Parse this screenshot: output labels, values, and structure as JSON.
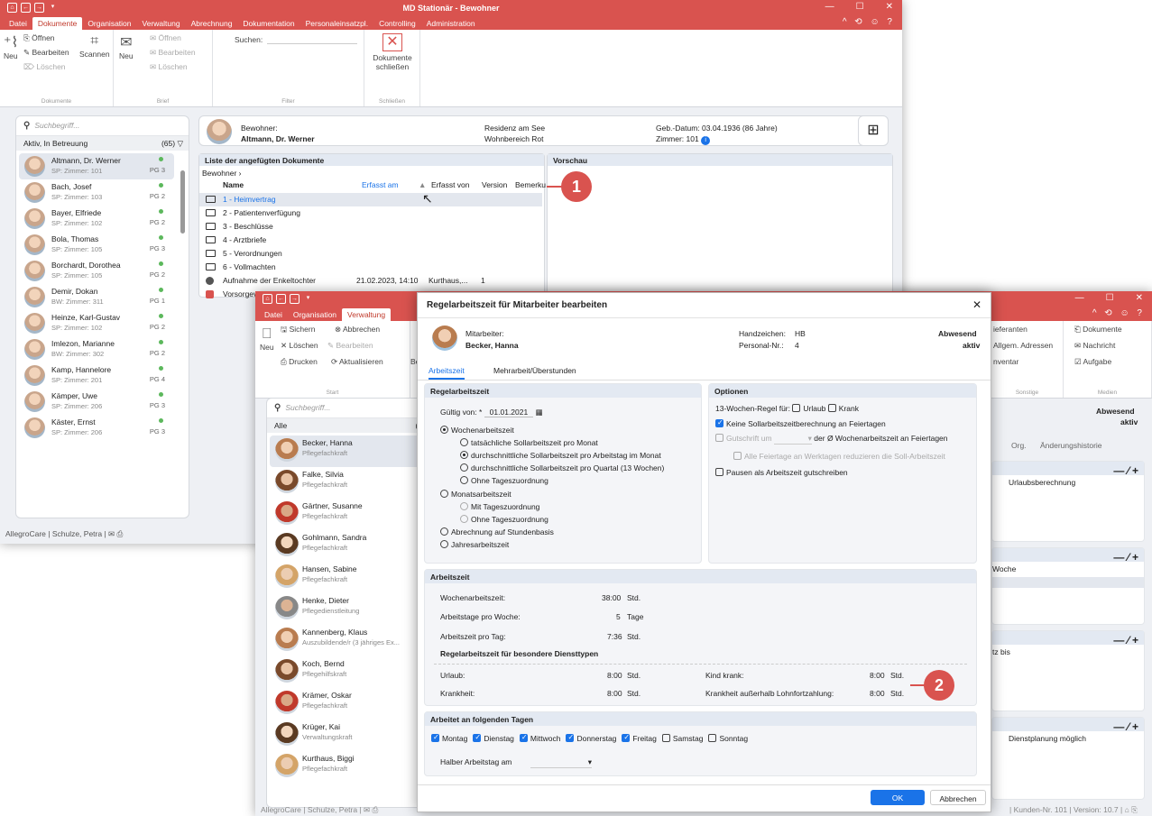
{
  "win1": {
    "title": "MD Stationär - Bewohner",
    "menu": [
      "Datei",
      "Dokumente",
      "Organisation",
      "Verwaltung",
      "Abrechnung",
      "Dokumentation",
      "Personaleinsatzpl.",
      "Controlling",
      "Administration"
    ],
    "ribbon": {
      "open": "Öffnen",
      "edit": "Bearbeiten",
      "delete": "Löschen",
      "new": "Neu",
      "scan": "Scannen",
      "new2": "Neu",
      "open2": "Öffnen",
      "edit2": "Bearbeiten",
      "delete2": "Löschen",
      "search_label": "Suchen:",
      "close_docs_1": "Dokumente",
      "close_docs_2": "schließen",
      "grp_docs": "Dokumente",
      "grp_brief": "Brief",
      "grp_filter": "Filter",
      "grp_close": "Schließen"
    },
    "search_placeholder": "Suchbegriff...",
    "filter_label": "Aktiv, In Betreuung",
    "filter_count": "(65)",
    "residents": [
      {
        "name": "Altmann, Dr. Werner",
        "room": "SP: Zimmer: 101",
        "pg": "PG 3"
      },
      {
        "name": "Bach, Josef",
        "room": "SP: Zimmer: 103",
        "pg": "PG 2"
      },
      {
        "name": "Bayer, Elfriede",
        "room": "SP: Zimmer: 102",
        "pg": "PG 2"
      },
      {
        "name": "Bola, Thomas",
        "room": "SP: Zimmer: 105",
        "pg": "PG 3"
      },
      {
        "name": "Borchardt, Dorothea",
        "room": "SP: Zimmer: 105",
        "pg": "PG 2"
      },
      {
        "name": "Demir, Dokan",
        "room": "BW: Zimmer: 311",
        "pg": "PG 1"
      },
      {
        "name": "Heinze, Karl-Gustav",
        "room": "SP: Zimmer: 102",
        "pg": "PG 2"
      },
      {
        "name": "Imlezon, Marianne",
        "room": "BW: Zimmer: 302",
        "pg": "PG 2"
      },
      {
        "name": "Kamp, Hannelore",
        "room": "SP: Zimmer: 201",
        "pg": "PG 4"
      },
      {
        "name": "Kämper, Uwe",
        "room": "SP: Zimmer: 206",
        "pg": "PG 3"
      },
      {
        "name": "Käster, Ernst",
        "room": "SP: Zimmer: 206",
        "pg": "PG 3"
      }
    ],
    "status": "AllegroCare | Schulze, Petra |",
    "header": {
      "label": "Bewohner:",
      "name": "Altmann, Dr. Werner",
      "place": "Residenz am See",
      "area": "Wohnbereich Rot",
      "birth": "Geb.-Datum: 03.04.1936 (86 Jahre)",
      "room": "Zimmer: 101"
    },
    "doc_list_title": "Liste der angefügten Dokumente",
    "preview_title": "Vorschau",
    "breadcrumb": "Bewohner ›",
    "cols": {
      "name": "Name",
      "date": "Erfasst am",
      "by": "Erfasst von",
      "version": "Version",
      "note": "Bemerku"
    },
    "docs": [
      {
        "name": "1 - Heimvertrag",
        "date": "",
        "by": "",
        "version": ""
      },
      {
        "name": "2 - Patientenverfügung",
        "date": "",
        "by": "",
        "version": ""
      },
      {
        "name": "3 - Beschlüsse",
        "date": "",
        "by": "",
        "version": ""
      },
      {
        "name": "4 - Arztbriefe",
        "date": "",
        "by": "",
        "version": ""
      },
      {
        "name": "5 - Verordnungen",
        "date": "",
        "by": "",
        "version": ""
      },
      {
        "name": "6 - Vollmachten",
        "date": "",
        "by": "",
        "version": ""
      },
      {
        "name": "Aufnahme der Enkeltochter",
        "date": "21.02.2023, 14:10",
        "by": "Kurthaus,...",
        "version": "1"
      },
      {
        "name": "Vorsorgev",
        "date": "",
        "by": "",
        "version": ""
      }
    ]
  },
  "win2": {
    "menu": [
      "Datei",
      "Organisation",
      "Verwaltung"
    ],
    "ribbon": {
      "new": "Neu",
      "save": "Sichern",
      "cancel": "Abbrechen",
      "delete": "Löschen",
      "edit": "Bearbeiten",
      "print": "Drucken",
      "refresh": "Aktualisieren",
      "grp_start": "Start",
      "be": "Be",
      "suppliers": "ieferanten",
      "addresses": "Allgem. Adressen",
      "inventory": "nventar",
      "documents": "Dokumente",
      "message": "Nachricht",
      "task": "Aufgabe",
      "grp_other": "Sonstige",
      "grp_media": "Medien"
    },
    "search_placeholder": "Suchbegriff...",
    "filter_label": "Alle",
    "filter_count": "(2",
    "staff": [
      {
        "name": "Becker, Hanna",
        "role": "Pflegefachkraft"
      },
      {
        "name": "Falke, Silvia",
        "role": "Pflegefachkraft"
      },
      {
        "name": "Gärtner, Susanne",
        "role": "Pflegefachkraft"
      },
      {
        "name": "Gohlmann, Sandra",
        "role": "Pflegefachkraft"
      },
      {
        "name": "Hansen, Sabine",
        "role": "Pflegefachkraft"
      },
      {
        "name": "Henke, Dieter",
        "role": "Pflegedienstleitung"
      },
      {
        "name": "Kannenberg, Klaus",
        "role": "Auszubildende/r (3 jähriges Ex..."
      },
      {
        "name": "Koch, Bernd",
        "role": "Pflegehilfskraft"
      },
      {
        "name": "Krämer, Oskar",
        "role": "Pflegefachkraft"
      },
      {
        "name": "Krüger, Kai",
        "role": "Verwaltungskraft"
      },
      {
        "name": "Kurthaus, Biggi",
        "role": "Pflegefachkraft"
      }
    ],
    "right": {
      "absent": "Abwesend",
      "active": "aktiv",
      "tab_org": "Org.",
      "tab_hist": "Änderungshistorie",
      "col_vac": "Urlaubsberechnung",
      "col_week": "Woche",
      "col_until": "tz bis",
      "col_plan": "Dienstplanung möglich"
    },
    "status": "AllegroCare | Schulze, Petra |",
    "status_right": "| Kunden-Nr. 101 | Version: 10.7 |"
  },
  "dialog": {
    "title": "Regelarbeitszeit für Mitarbeiter bearbeiten",
    "emp_label": "Mitarbeiter:",
    "emp_name": "Becker, Hanna",
    "hz_label": "Handzeichen:",
    "hz": "HB",
    "pn_label": "Personal-Nr.:",
    "pn": "4",
    "absent": "Abwesend",
    "active": "aktiv",
    "tabs": [
      "Arbeitszeit",
      "Mehrarbeit/Überstunden"
    ],
    "s1": {
      "title": "Regelarbeitszeit",
      "valid_label": "Gültig von:",
      "valid": "01.01.2021",
      "r_week": "Wochenarbeitszeit",
      "r_w1": "tatsächliche Sollarbeitszeit pro Monat",
      "r_w2": "durchschnittliche Sollarbeitszeit pro Arbeitstag im Monat",
      "r_w3": "durchschnittliche Sollarbeitszeit pro Quartal (13 Wochen)",
      "r_w4": "Ohne Tageszuordnung",
      "r_month": "Monatsarbeitszeit",
      "r_m1": "Mit Tageszuordnung",
      "r_m2": "Ohne Tageszuordnung",
      "r_hours": "Abrechnung auf Stundenbasis",
      "r_year": "Jahresarbeitszeit"
    },
    "s2": {
      "title": "Optionen",
      "rule": "13-Wochen-Regel für:",
      "vac": "Urlaub",
      "sick": "Krank",
      "no_holiday": "Keine Sollarbeitszeitberechnung an Feiertagen",
      "credit": "Gutschrift um",
      "credit2": "der Ø Wochenarbeitszeit an Feiertagen",
      "all_holidays": "Alle Feiertage an Werktagen reduzieren die Soll-Arbeitszeit",
      "pauses": "Pausen als Arbeitszeit gutschreiben"
    },
    "s3": {
      "title": "Arbeitszeit",
      "week_l": "Wochenarbeitszeit:",
      "week_v": "38:00",
      "week_u": "Std.",
      "days_l": "Arbeitstage pro Woche:",
      "days_v": "5",
      "days_u": "Tage",
      "day_l": "Arbeitszeit pro Tag:",
      "day_v": "7:36",
      "day_u": "Std.",
      "special": "Regelarbeitszeit für besondere Diensttypen",
      "vac_l": "Urlaub:",
      "vac_v": "8:00",
      "vac_u": "Std.",
      "kid_l": "Kind krank:",
      "kid_v": "8:00",
      "kid_u": "Std.",
      "sick_l": "Krankheit:",
      "sick_v": "8:00",
      "sick_u": "Std.",
      "sick2_l": "Krankheit außerhalb Lohnfortzahlung:",
      "sick2_v": "8:00",
      "sick2_u": "Std."
    },
    "s4": {
      "title": "Arbeitet an folgenden Tagen",
      "days": [
        {
          "l": "Montag",
          "on": true
        },
        {
          "l": "Dienstag",
          "on": true
        },
        {
          "l": "Mittwoch",
          "on": true
        },
        {
          "l": "Donnerstag",
          "on": true
        },
        {
          "l": "Freitag",
          "on": true
        },
        {
          "l": "Samstag",
          "on": false
        },
        {
          "l": "Sonntag",
          "on": false
        }
      ],
      "half": "Halber Arbeitstag am"
    },
    "ok": "OK",
    "cancel": "Abbrechen"
  },
  "callouts": [
    "1",
    "2"
  ],
  "colors": {
    "brand": "#d9534f",
    "accent": "#1a73e8",
    "active": "#5cb85c"
  }
}
